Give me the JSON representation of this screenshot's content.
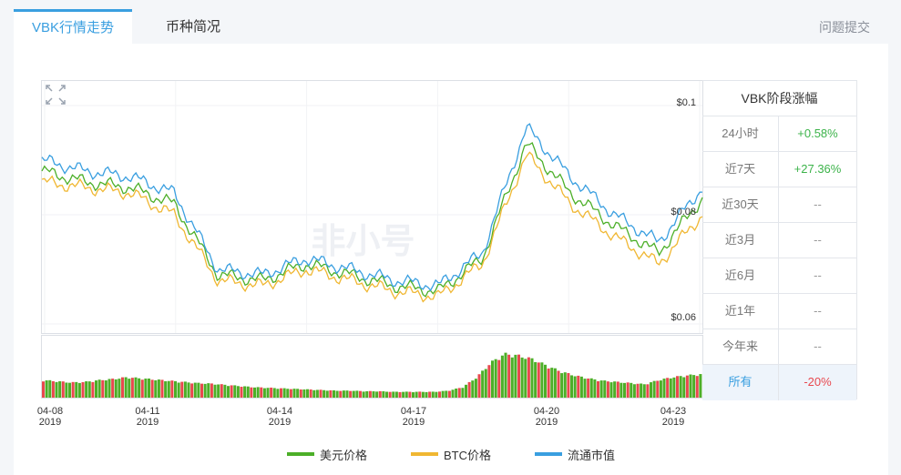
{
  "tabs": [
    {
      "label": "VBK行情走势",
      "active": true
    },
    {
      "label": "币种简况",
      "active": false
    }
  ],
  "report_link": "问题提交",
  "watermark": "非小号",
  "chart_data": {
    "type": "line",
    "x": [
      "04-08 2019",
      "04-09",
      "04-10",
      "04-11 2019",
      "04-12",
      "04-13",
      "04-14 2019",
      "04-15",
      "04-16",
      "04-17 2019",
      "04-18",
      "04-19",
      "04-20 2019",
      "04-21",
      "04-22",
      "04-23 2019"
    ],
    "x_tick_labels": [
      {
        "date": "04-08",
        "year": "2019"
      },
      {
        "date": "04-11",
        "year": "2019"
      },
      {
        "date": "04-14",
        "year": "2019"
      },
      {
        "date": "04-17",
        "year": "2019"
      },
      {
        "date": "04-20",
        "year": "2019"
      },
      {
        "date": "04-23",
        "year": "2019"
      }
    ],
    "y_tick_labels": [
      "$0.1",
      "$0.08",
      "$0.06"
    ],
    "ylim": [
      0.06,
      0.1
    ],
    "series": [
      {
        "name": "美元价格",
        "color": "#4caf28",
        "values": [
          0.088,
          0.086,
          0.085,
          0.082,
          0.069,
          0.068,
          0.071,
          0.069,
          0.067,
          0.066,
          0.072,
          0.093,
          0.084,
          0.078,
          0.073,
          0.083
        ]
      },
      {
        "name": "BTC价格",
        "color": "#f0b732",
        "values": [
          0.086,
          0.085,
          0.084,
          0.08,
          0.068,
          0.067,
          0.07,
          0.068,
          0.066,
          0.065,
          0.071,
          0.091,
          0.082,
          0.076,
          0.071,
          0.08
        ]
      },
      {
        "name": "流通市值",
        "color": "#3a9fe0",
        "values": [
          0.09,
          0.088,
          0.087,
          0.084,
          0.07,
          0.069,
          0.072,
          0.07,
          0.068,
          0.067,
          0.073,
          0.096,
          0.087,
          0.08,
          0.075,
          0.085
        ]
      }
    ],
    "volume_bars": [
      0.3,
      0.28,
      0.26,
      0.27,
      0.3,
      0.32,
      0.35,
      0.33,
      0.31,
      0.29,
      0.27,
      0.25,
      0.24,
      0.22,
      0.2,
      0.18,
      0.17,
      0.16,
      0.15,
      0.14,
      0.13,
      0.12,
      0.12,
      0.11,
      0.11,
      0.1,
      0.1,
      0.1,
      0.1,
      0.12,
      0.18,
      0.35,
      0.6,
      0.75,
      0.72,
      0.66,
      0.55,
      0.45,
      0.38,
      0.33,
      0.29,
      0.27,
      0.25,
      0.23,
      0.3,
      0.35,
      0.38,
      0.4
    ],
    "volume_colors": [
      "#4caf28",
      "#e8484e"
    ],
    "grid": true
  },
  "stats": {
    "title": "VBK阶段涨幅",
    "rows": [
      {
        "label": "24小时",
        "value": "+0.58%",
        "trend": "up"
      },
      {
        "label": "近7天",
        "value": "+27.36%",
        "trend": "up"
      },
      {
        "label": "近30天",
        "value": "--",
        "trend": "none"
      },
      {
        "label": "近3月",
        "value": "--",
        "trend": "none"
      },
      {
        "label": "近6月",
        "value": "--",
        "trend": "none"
      },
      {
        "label": "近1年",
        "value": "--",
        "trend": "none"
      },
      {
        "label": "今年来",
        "value": "--",
        "trend": "none"
      },
      {
        "label": "所有",
        "value": "-20%",
        "trend": "down"
      }
    ]
  }
}
